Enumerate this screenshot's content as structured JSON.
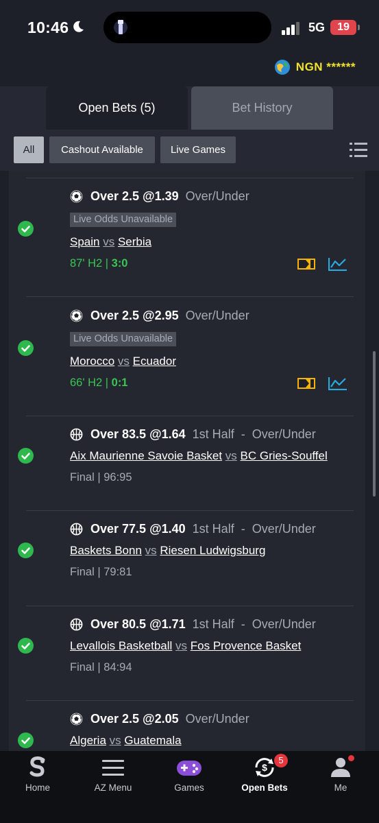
{
  "status_bar": {
    "time": "10:46",
    "network": "5G",
    "battery": "19"
  },
  "currency": {
    "label": "NGN ******"
  },
  "tabs": [
    {
      "label": "Open Bets (5)",
      "active": true
    },
    {
      "label": "Bet History",
      "active": false
    }
  ],
  "filters": [
    {
      "label": "All",
      "selected": true
    },
    {
      "label": "Cashout Available",
      "selected": false
    },
    {
      "label": "Live Games",
      "selected": false
    }
  ],
  "bets": [
    {
      "sport": "football-icon",
      "selection": "Over 2.5 @1.39",
      "market": "Over/Under",
      "odds_note": "Live Odds Unavailable",
      "home": "Spain",
      "vs": "vs",
      "away": "Serbia",
      "status_prefix": "87' H2 | ",
      "status_score": "3:0",
      "live": true
    },
    {
      "sport": "football-icon",
      "selection": "Over 2.5 @2.95",
      "market": "Over/Under",
      "odds_note": "Live Odds Unavailable",
      "home": "Morocco",
      "vs": "vs",
      "away": "Ecuador",
      "status_prefix": "66' H2 | ",
      "status_score": "0:1",
      "live": true
    },
    {
      "sport": "basketball-icon",
      "selection": "Over 83.5 @1.64",
      "market": "1st Half  -  Over/Under",
      "home": "Aix Maurienne Savoie Basket",
      "vs": "vs",
      "away": "BC Gries-Souffel",
      "status": "Final | 96:95",
      "live": false
    },
    {
      "sport": "basketball-icon",
      "selection": "Over 77.5 @1.40",
      "market": "1st Half  -  Over/Under",
      "home": "Baskets Bonn",
      "vs": "vs",
      "away": "Riesen Ludwigsburg",
      "status": "Final | 79:81",
      "live": false
    },
    {
      "sport": "basketball-icon",
      "selection": "Over 80.5 @1.71",
      "market": "1st Half  -  Over/Under",
      "home": "Levallois Basketball",
      "vs": "vs",
      "away": "Fos Provence Basket",
      "status": "Final | 84:94",
      "live": false
    },
    {
      "sport": "football-icon",
      "selection": "Over 2.5 @2.05",
      "market": "Over/Under",
      "home": "Algeria",
      "vs": "vs",
      "away": "Guatemala",
      "live": false
    }
  ],
  "bottom_nav": [
    {
      "label": "Home",
      "icon": "sporty-logo-icon"
    },
    {
      "label": "AZ Menu",
      "icon": "menu-icon"
    },
    {
      "label": "Games",
      "icon": "gamepad-icon"
    },
    {
      "label": "Open Bets",
      "icon": "open-bets-icon",
      "badge": "5",
      "active": true
    },
    {
      "label": "Me",
      "icon": "user-icon"
    }
  ],
  "colors": {
    "background": "#1d2029",
    "live_green": "#3bc553",
    "currency_yellow": "#f2e32a",
    "stats_blue": "#2aa9e0",
    "stream_yellow": "#f5b400",
    "badge_red": "#e5353d"
  }
}
